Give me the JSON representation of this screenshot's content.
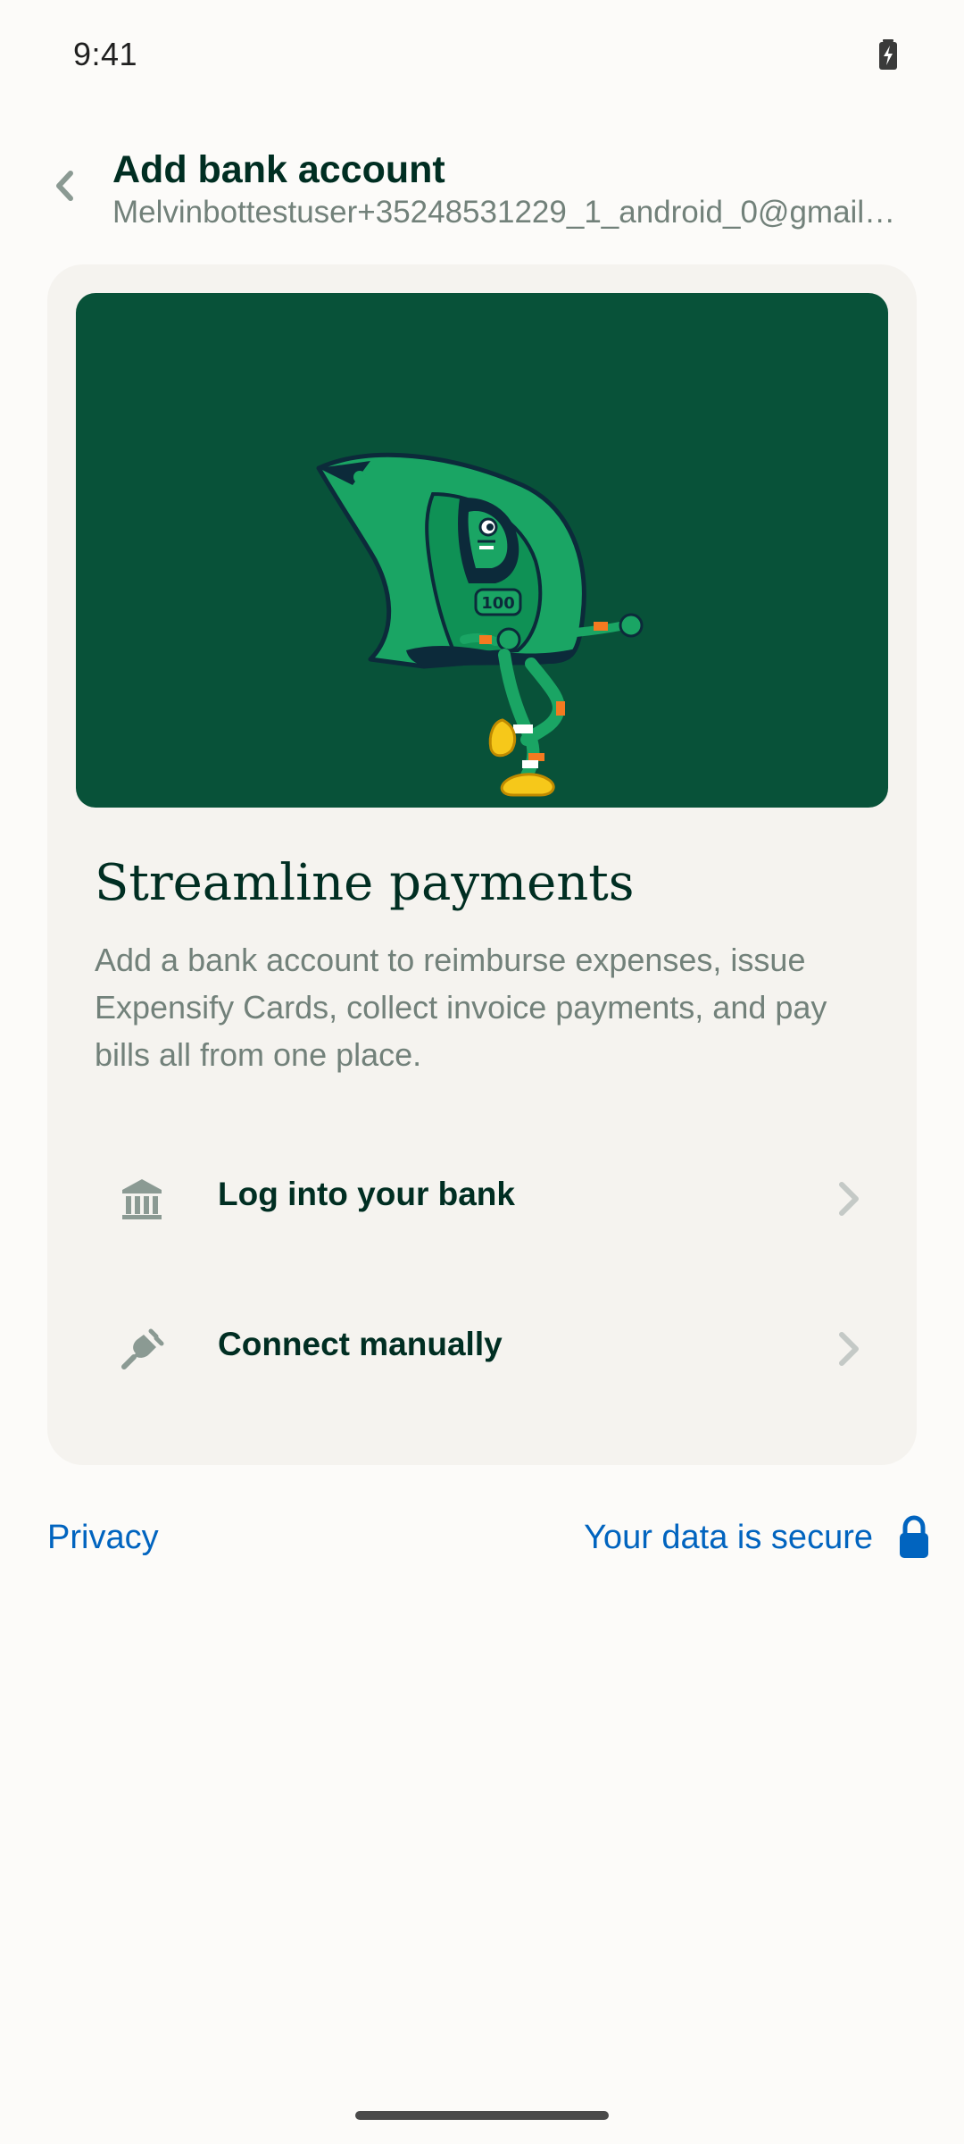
{
  "status_bar": {
    "time": "9:41",
    "battery_icon": "battery-charging-icon"
  },
  "header": {
    "back_icon": "chevron-left-icon",
    "title": "Add bank account",
    "subtitle": "Melvinbottestuser+35248531229_1_android_0@gmail.co..."
  },
  "hero": {
    "illustration": "dancing-dollar-bill-illustration",
    "bill_denomination": "100"
  },
  "card": {
    "title": "Streamline payments",
    "description": "Add a bank account to reimburse expenses, issue Expensify Cards, collect invoice payments, and pay bills all from one place."
  },
  "options": [
    {
      "label": "Log into your bank",
      "icon": "bank-icon"
    },
    {
      "label": "Connect manually",
      "icon": "plug-icon"
    }
  ],
  "footer": {
    "privacy": "Privacy",
    "secure": "Your data is secure",
    "secure_icon": "lock-icon"
  },
  "colors": {
    "background": "#FCFBF9",
    "card": "#F5F3EF",
    "hero": "#085239",
    "text": "#002E22",
    "muted": "#72817A",
    "link": "#0164BF"
  }
}
